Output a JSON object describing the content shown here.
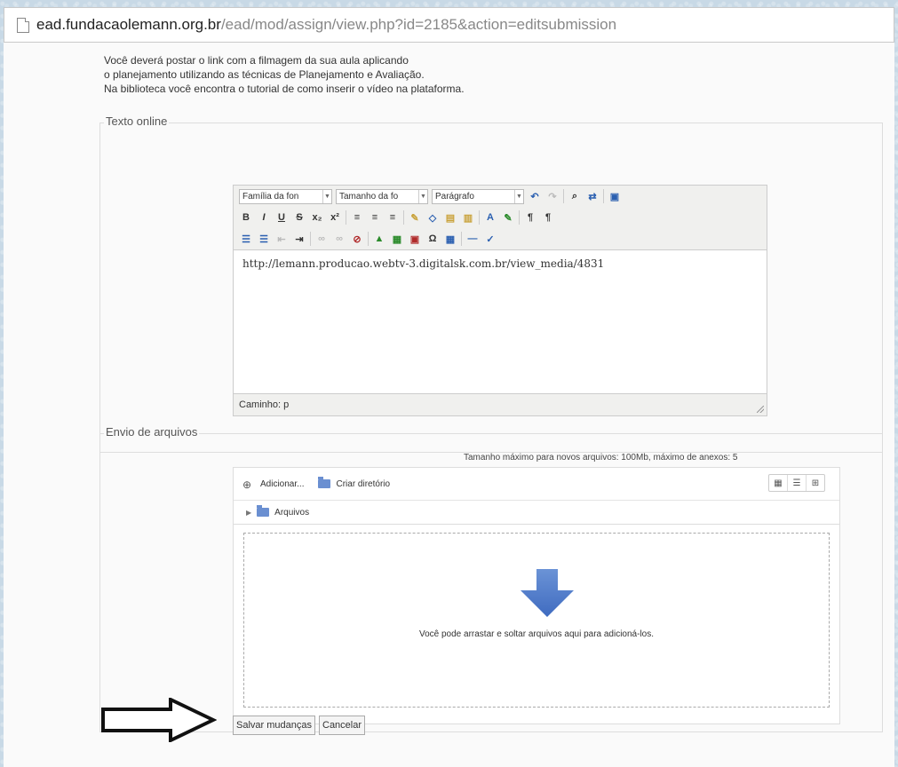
{
  "address_bar": {
    "domain": "ead.fundacaolemann.org.br",
    "path": "/ead/mod/assign/view.php?id=2185&action=editsubmission"
  },
  "intro": {
    "line1": "Você deverá postar o link com a filmagem da sua aula aplicando",
    "line2": "o planejamento utilizando as técnicas de Planejamento e Avaliação.",
    "line3": "Na biblioteca você encontra o tutorial de como inserir o vídeo na plataforma."
  },
  "online_text": {
    "legend": "Texto online",
    "font_family_select": "Família da fon",
    "font_size_select": "Tamanho da fo",
    "format_select": "Parágrafo",
    "content": "http://lemann.producao.webtv-3.digitalsk.com.br/view_media/4831",
    "status_path": "Caminho: p"
  },
  "file_submission": {
    "legend": "Envio de arquivos",
    "max_size": "Tamanho máximo para novos arquivos: 100Mb, máximo de anexos: 5",
    "add_label": "Adicionar...",
    "create_dir_label": "Criar diretório",
    "folder_label": "Arquivos",
    "drop_text": "Você pode arrastar e soltar arquivos aqui para adicioná-los."
  },
  "actions": {
    "save_label": "Salvar mudanças",
    "cancel_label": "Cancelar"
  },
  "colors": {
    "accent_blue": "#4a76c9",
    "background": "#c8d9e6"
  }
}
